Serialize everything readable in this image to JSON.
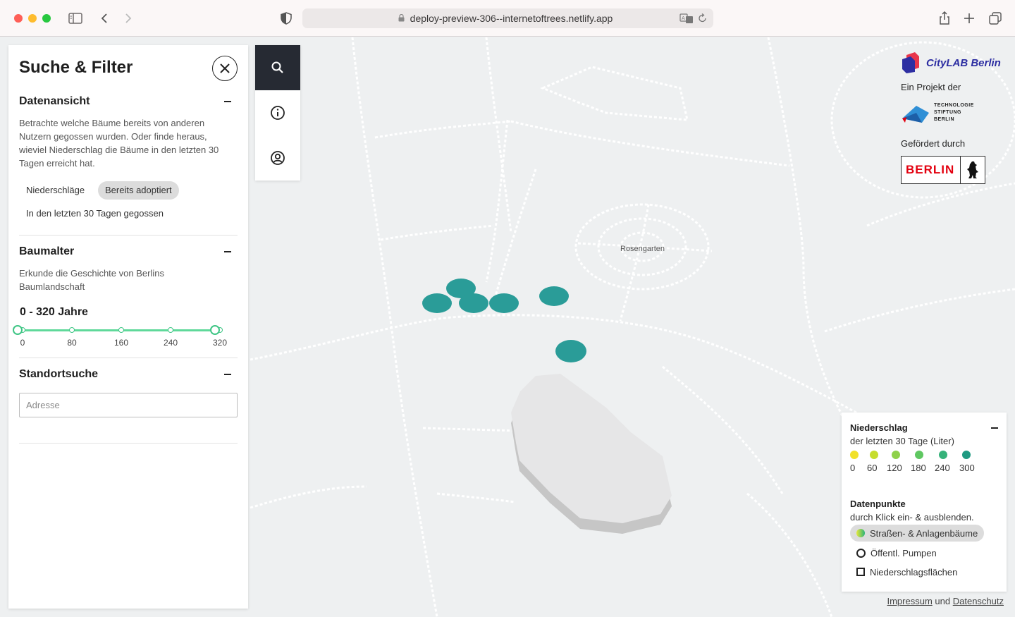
{
  "browser": {
    "url": "deploy-preview-306--internetoftrees.netlify.app"
  },
  "sidebar": {
    "title": "Suche & Filter",
    "datenansicht": {
      "heading": "Datenansicht",
      "description": "Betrachte welche Bäume bereits von anderen Nutzern gegossen wurden. Oder finde heraus, wieviel Niederschlag die Bäume in den letzten 30 Tagen erreicht hat.",
      "tags": [
        "Niederschläge",
        "Bereits adoptiert",
        "In den letzten 30 Tagen gegossen"
      ],
      "active_tag": "Bereits adoptiert"
    },
    "baumalter": {
      "heading": "Baumalter",
      "description": "Erkunde die Geschichte von Berlins Baumlandschaft",
      "range_label": "0 - 320 Jahre",
      "range_min": 0,
      "range_max": 320,
      "ticks": [
        "0",
        "80",
        "160",
        "240",
        "320"
      ]
    },
    "standortsuche": {
      "heading": "Standortsuche",
      "placeholder": "Adresse"
    }
  },
  "toolbar": {
    "items": [
      "search-icon",
      "info-icon",
      "user-icon"
    ],
    "active": "search-icon"
  },
  "map": {
    "labels": {
      "rosengarten": "Rosengarten"
    },
    "tree_color": "#2a9c98"
  },
  "credits": {
    "citylab": "CityLAB Berlin",
    "projekt": "Ein Projekt der",
    "tsb": "TECHNOLOGIE STIFTUNG BERLIN",
    "gefoerdert": "Gefördert durch",
    "berlin": "BERLIN"
  },
  "legend": {
    "niederschlag_heading": "Niederschlag",
    "niederschlag_sub": "der letzten 30 Tage (Liter)",
    "scale": [
      {
        "label": "0",
        "color": "#f1e12a"
      },
      {
        "label": "60",
        "color": "#c6dd2e"
      },
      {
        "label": "120",
        "color": "#8fd14a"
      },
      {
        "label": "180",
        "color": "#5fc761"
      },
      {
        "label": "240",
        "color": "#36b27a"
      },
      {
        "label": "300",
        "color": "#1f9a82"
      }
    ],
    "datenpunkte_heading": "Datenpunkte",
    "datenpunkte_sub": "durch Klick ein- & ausblenden.",
    "items": [
      "Straßen- & Anlagenbäume",
      "Öffentl. Pumpen",
      "Niederschlagsflächen"
    ]
  },
  "footer": {
    "impressum": "Impressum",
    "und": "und",
    "datenschutz": "Datenschutz"
  }
}
